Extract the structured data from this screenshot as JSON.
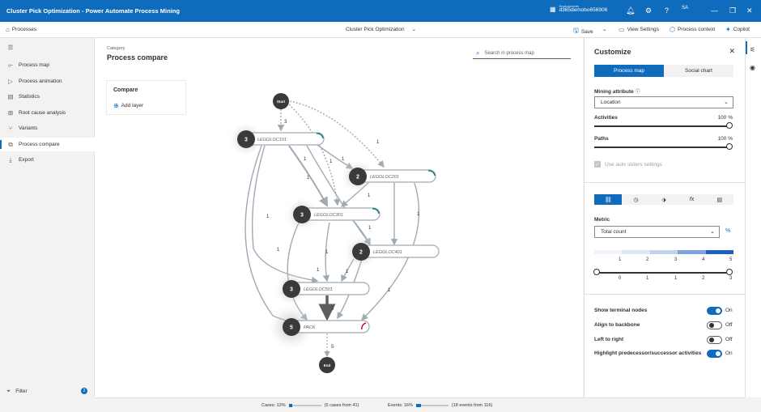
{
  "app": {
    "title": "Cluster Pick Optimization - Power Automate Process Mining",
    "env_label": "Environments",
    "env_name": "d365demobo656906",
    "user_initials": "SA"
  },
  "cmdbar": {
    "processes": "Processes",
    "center_title": "Cluster Pick Optimization",
    "save": "Save",
    "view_settings": "View Settings",
    "process_context": "Process context",
    "copilot": "Copilot"
  },
  "sidebar": {
    "items": [
      {
        "label": "Process map",
        "icon": "process-map-icon"
      },
      {
        "label": "Process animation",
        "icon": "play-icon"
      },
      {
        "label": "Statistics",
        "icon": "statistics-icon"
      },
      {
        "label": "Root cause analysis",
        "icon": "root-cause-icon"
      },
      {
        "label": "Variants",
        "icon": "variants-icon"
      },
      {
        "label": "Process compare",
        "icon": "compare-icon"
      },
      {
        "label": "Export",
        "icon": "export-icon"
      }
    ],
    "filter": "Filter",
    "filter_count": "2"
  },
  "main": {
    "category": "Category",
    "title": "Process compare",
    "search_placeholder": "Search in process map",
    "compare_title": "Compare",
    "add_layer": "Add layer"
  },
  "map": {
    "start": "Start",
    "end": "End",
    "nodes": [
      {
        "id": "n1",
        "label": "LEGOLOC101",
        "count": "3"
      },
      {
        "id": "n2",
        "label": "LEGOLOC201",
        "count": "2"
      },
      {
        "id": "n3",
        "label": "LEGOLOC301",
        "count": "3"
      },
      {
        "id": "n4",
        "label": "LEGOLOC401",
        "count": "2"
      },
      {
        "id": "n5",
        "label": "LEGOLOC501",
        "count": "3"
      },
      {
        "id": "n6",
        "label": "PACK",
        "count": "5"
      }
    ],
    "edge_labels": [
      "3",
      "1",
      "1",
      "1",
      "1",
      "1",
      "1",
      "1",
      "1",
      "1",
      "1",
      "1",
      "1",
      "1",
      "1",
      "3",
      "5"
    ]
  },
  "customize": {
    "title": "Customize",
    "tab_process_map": "Process map",
    "tab_social_chart": "Social chart",
    "mining_attribute_label": "Mining attribute",
    "mining_attribute_value": "Location",
    "activities_label": "Activities",
    "activities_value": "100 %",
    "activities_level": 1.0,
    "paths_label": "Paths",
    "paths_value": "100 %",
    "paths_level": 1.0,
    "auto_sliders": "Use auto sliders settings",
    "metric_label": "Metric",
    "metric_value": "Total count",
    "pct_symbol": "%",
    "scale_top": [
      "1",
      "2",
      "3",
      "4",
      "5"
    ],
    "scale_bottom": [
      "0",
      "1",
      "1",
      "2",
      "3"
    ],
    "toggles": [
      {
        "label": "Show terminal nodes",
        "state": "On",
        "on": true
      },
      {
        "label": "Align to backbone",
        "state": "Off",
        "on": false
      },
      {
        "label": "Left to right",
        "state": "Off",
        "on": false
      },
      {
        "label": "Highlight predecessor/successor activities",
        "state": "On",
        "on": true
      }
    ]
  },
  "status": {
    "cases_label": "Cases: 12%",
    "cases_detail": "(5 cases from 41)",
    "cases_fraction": 0.12,
    "events_label": "Events: 16%",
    "events_detail": "(18 events from 116)",
    "events_fraction": 0.16
  },
  "colors": {
    "accent": "#0f6cbd",
    "node": "#3b3a39",
    "edge": "#a0aab4"
  }
}
